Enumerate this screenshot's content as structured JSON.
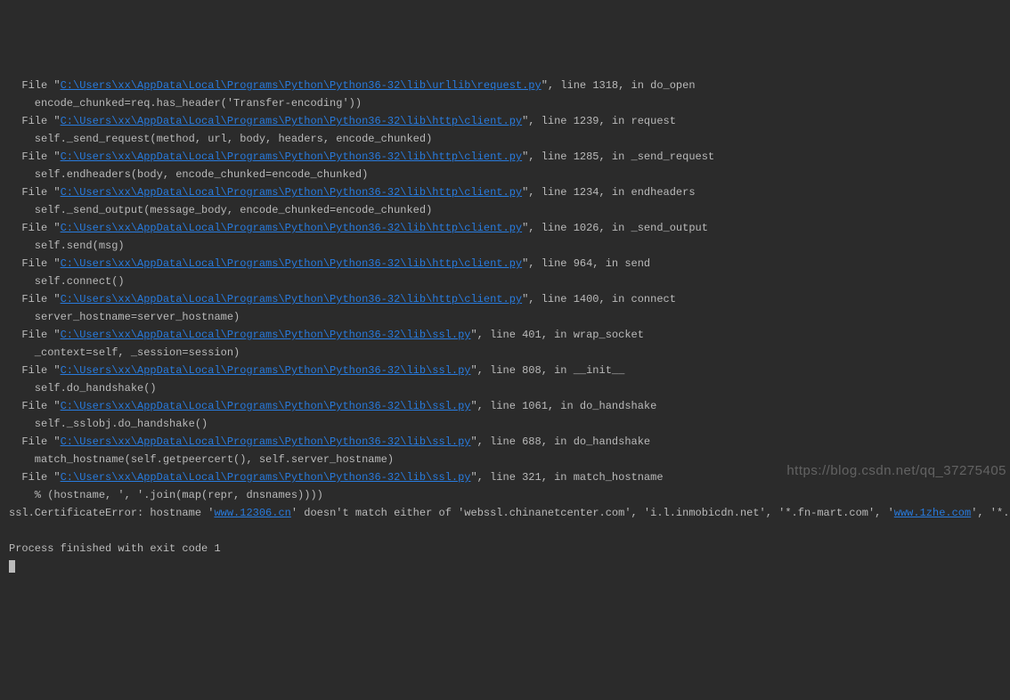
{
  "traceback": [
    {
      "path": "C:\\Users\\xx\\AppData\\Local\\Programs\\Python\\Python36-32\\lib\\urllib\\request.py",
      "line": "1318",
      "func": "do_open",
      "code": "encode_chunked=req.has_header('Transfer-encoding'))"
    },
    {
      "path": "C:\\Users\\xx\\AppData\\Local\\Programs\\Python\\Python36-32\\lib\\http\\client.py",
      "line": "1239",
      "func": "request",
      "code": "self._send_request(method, url, body, headers, encode_chunked)"
    },
    {
      "path": "C:\\Users\\xx\\AppData\\Local\\Programs\\Python\\Python36-32\\lib\\http\\client.py",
      "line": "1285",
      "func": "_send_request",
      "code": "self.endheaders(body, encode_chunked=encode_chunked)"
    },
    {
      "path": "C:\\Users\\xx\\AppData\\Local\\Programs\\Python\\Python36-32\\lib\\http\\client.py",
      "line": "1234",
      "func": "endheaders",
      "code": "self._send_output(message_body, encode_chunked=encode_chunked)"
    },
    {
      "path": "C:\\Users\\xx\\AppData\\Local\\Programs\\Python\\Python36-32\\lib\\http\\client.py",
      "line": "1026",
      "func": "_send_output",
      "code": "self.send(msg)"
    },
    {
      "path": "C:\\Users\\xx\\AppData\\Local\\Programs\\Python\\Python36-32\\lib\\http\\client.py",
      "line": "964",
      "func": "send",
      "code": "self.connect()"
    },
    {
      "path": "C:\\Users\\xx\\AppData\\Local\\Programs\\Python\\Python36-32\\lib\\http\\client.py",
      "line": "1400",
      "func": "connect",
      "code": "server_hostname=server_hostname)"
    },
    {
      "path": "C:\\Users\\xx\\AppData\\Local\\Programs\\Python\\Python36-32\\lib\\ssl.py",
      "line": "401",
      "func": "wrap_socket",
      "code": "_context=self, _session=session)"
    },
    {
      "path": "C:\\Users\\xx\\AppData\\Local\\Programs\\Python\\Python36-32\\lib\\ssl.py",
      "line": "808",
      "func": "__init__",
      "code": "self.do_handshake()"
    },
    {
      "path": "C:\\Users\\xx\\AppData\\Local\\Programs\\Python\\Python36-32\\lib\\ssl.py",
      "line": "1061",
      "func": "do_handshake",
      "code": "self._sslobj.do_handshake()"
    },
    {
      "path": "C:\\Users\\xx\\AppData\\Local\\Programs\\Python\\Python36-32\\lib\\ssl.py",
      "line": "688",
      "func": "do_handshake",
      "code": "match_hostname(self.getpeercert(), self.server_hostname)"
    },
    {
      "path": "C:\\Users\\xx\\AppData\\Local\\Programs\\Python\\Python36-32\\lib\\ssl.py",
      "line": "321",
      "func": "match_hostname",
      "code": "% (hostname, ', '.join(map(repr, dnsnames))))"
    }
  ],
  "file_prefix": "  File \"",
  "line_prefix": "\", line ",
  "in_prefix": ", in ",
  "code_indent": "    ",
  "error": {
    "prefix": "ssl.CertificateError: hostname '",
    "link1": "www.12306.cn",
    "middle": "' doesn't match either of 'webssl.chinanetcenter.com', 'i.l.inmobicdn.net', '*.fn-mart.com', '",
    "link2": "www.1zhe.com",
    "suffix": "', '*.ping"
  },
  "exit_line": "Process finished with exit code 1",
  "watermark": "https://blog.csdn.net/qq_37275405"
}
